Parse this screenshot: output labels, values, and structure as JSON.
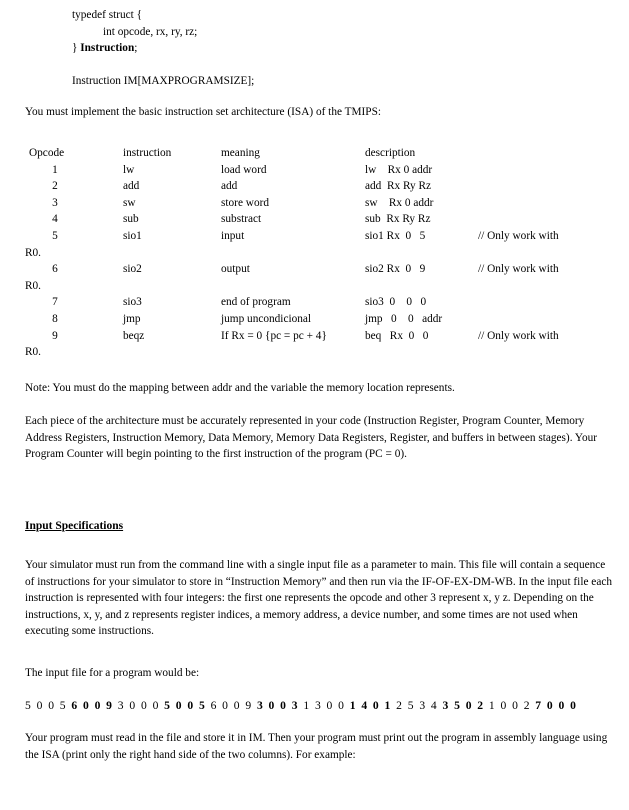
{
  "document": {
    "code_block": {
      "lines": [
        {
          "text": "typedef struct {",
          "indent": 1,
          "bold_part": ""
        },
        {
          "text": "int opcode, rx, ry, rz;",
          "indent": 2,
          "bold_part": ""
        },
        {
          "prefix": "} ",
          "bold_part": "Instruction",
          "suffix": ";",
          "indent": 1
        }
      ],
      "array_decl": "Instruction IM[MAXPROGRAMSIZE];"
    },
    "intro_paragraph": "You must implement the basic instruction set architecture (ISA) of the TMIPS:",
    "isa_table": {
      "headers": {
        "opcode": "Opcode",
        "instruction": "instruction",
        "meaning": "meaning",
        "description": "description"
      },
      "rows": [
        {
          "opcode": "1",
          "instruction": "lw",
          "meaning": "load word",
          "description": "lw    Rx 0 addr",
          "comment": "",
          "wrap": ""
        },
        {
          "opcode": "2",
          "instruction": "add",
          "meaning": "add",
          "description": "add  Rx Ry Rz",
          "comment": "",
          "wrap": ""
        },
        {
          "opcode": "3",
          "instruction": "sw",
          "meaning": "store word",
          "description": "sw    Rx 0 addr",
          "comment": "",
          "wrap": ""
        },
        {
          "opcode": "4",
          "instruction": "sub",
          "meaning": "substract",
          "description": "sub  Rx Ry Rz",
          "comment": "",
          "wrap": ""
        },
        {
          "opcode": "5",
          "instruction": "sio1",
          "meaning": "input",
          "description": "sio1 Rx  0   5",
          "comment": "// Only work with",
          "wrap": "R0."
        },
        {
          "opcode": "6",
          "instruction": "sio2",
          "meaning": "output",
          "description": "sio2 Rx  0   9",
          "comment": "// Only work with",
          "wrap": "R0."
        },
        {
          "opcode": "7",
          "instruction": "sio3",
          "meaning": "end of program",
          "description": "sio3  0    0   0",
          "comment": "",
          "wrap": ""
        },
        {
          "opcode": "8",
          "instruction": "jmp",
          "meaning": "jump uncondicional",
          "description": "jmp   0    0   addr",
          "comment": "",
          "wrap": ""
        },
        {
          "opcode": "9",
          "instruction": "beqz",
          "meaning": "If Rx = 0 {pc = pc + 4}",
          "description": "beq   Rx  0   0",
          "comment": "// Only work with",
          "wrap": "R0."
        }
      ]
    },
    "note_paragraph": "Note: You must do the mapping between addr and the variable the memory location represents.",
    "architecture_paragraph": "Each piece of the architecture must be accurately represented in your code (Instruction Register, Program Counter, Memory Address Registers, Instruction Memory, Data Memory, Memory Data Registers, Register, and buffers in between stages). Your Program Counter will begin pointing to the first instruction of the program (PC = 0).",
    "input_spec_heading": "Input Specifications",
    "input_spec_paragraph": "Your simulator must run from the command line with a single input file as a parameter to main. This file will contain a sequence of instructions for your simulator to store in “Instruction Memory” and then run via the IF-OF-EX-DM-WB. In the input file each instruction is represented with four integers: the first one represents the opcode and other 3 represent x, y z.  Depending on the instructions, x, y, and z represents register indices, a memory address, a device number, and some times are not used when executing some instructions.",
    "input_file_lead": "The input file for a program would be:",
    "input_file_digits": [
      {
        "text": "5 0 0 5 ",
        "bold": false
      },
      {
        "text": "6 0 0 9 ",
        "bold": true
      },
      {
        "text": "3 0 0 0 ",
        "bold": false
      },
      {
        "text": "5 0 0 5 ",
        "bold": true
      },
      {
        "text": "6 0 0 9 ",
        "bold": false
      },
      {
        "text": "3 0 0 3 ",
        "bold": true
      },
      {
        "text": "1 3 0 0 ",
        "bold": false
      },
      {
        "text": "1 4 0 1 ",
        "bold": true
      },
      {
        "text": "2 5 3 4 ",
        "bold": false
      },
      {
        "text": "3 5 0 2 ",
        "bold": true
      },
      {
        "text": "1 0 0 2 ",
        "bold": false
      },
      {
        "text": "7 0 0 0",
        "bold": true
      }
    ],
    "closing_paragraph": "Your program must read in the file and store it in IM. Then your program must print out the program in assembly language using the ISA (print only the right hand side of the two columns). For example:"
  }
}
